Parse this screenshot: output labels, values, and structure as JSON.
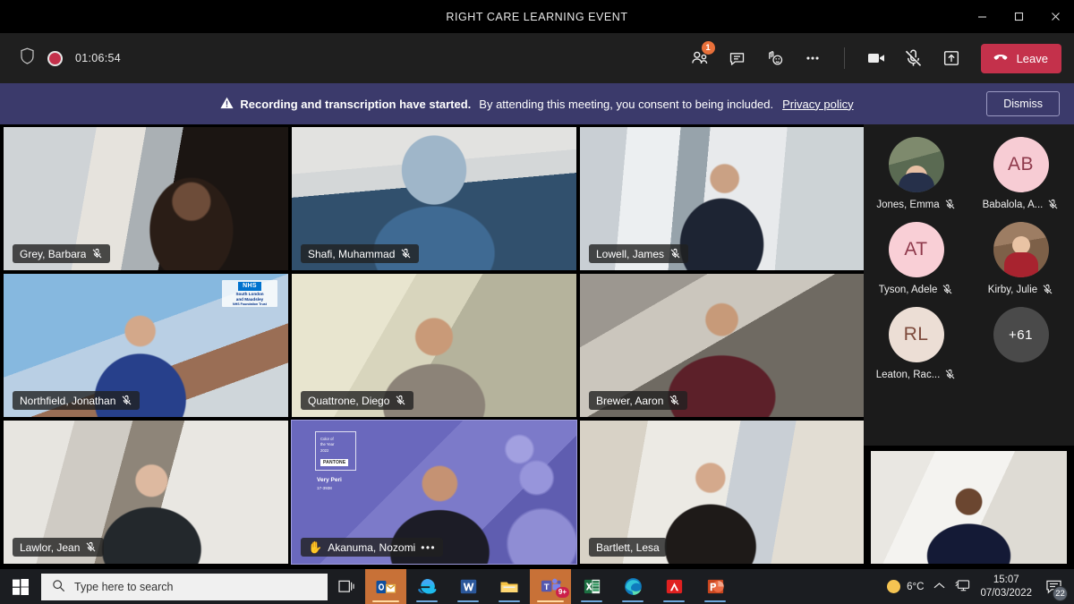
{
  "window": {
    "title": "RIGHT CARE LEARNING EVENT",
    "controls": [
      {
        "name": "minimize",
        "glyph": "minimize-icon"
      },
      {
        "name": "maximize",
        "glyph": "maximize-icon"
      },
      {
        "name": "close",
        "glyph": "close-icon"
      }
    ]
  },
  "toolbar": {
    "shield_icon": "shield-icon",
    "recording_icon": "recording-dot-icon",
    "timer": "01:06:54",
    "people_icon": "people-icon",
    "people_badge": "1",
    "chat_icon": "chat-icon",
    "reactions_icon": "raise-hand-reactions-icon",
    "more_icon": "more-options-icon",
    "camera_icon": "camera-icon",
    "mic_off_icon": "microphone-muted-icon",
    "share_icon": "share-screen-icon",
    "leave_label": "Leave",
    "leave_icon": "hangup-icon",
    "leave_color": "#c4314b"
  },
  "banner": {
    "warning_icon": "warning-icon",
    "strong": "Recording and transcription have started.",
    "text": "By attending this meeting, you consent to being included.",
    "link": "Privacy policy",
    "dismiss_label": "Dismiss",
    "background": "#3b3a6b"
  },
  "stage": {
    "tiles": [
      {
        "name": "Grey, Barbara",
        "muted": true,
        "hand_raised": false,
        "active": false,
        "more": false
      },
      {
        "name": "Shafi, Muhammad",
        "muted": true,
        "hand_raised": false,
        "active": false,
        "more": false
      },
      {
        "name": "Lowell, James",
        "muted": true,
        "hand_raised": false,
        "active": false,
        "more": false
      },
      {
        "name": "Northfield, Jonathan",
        "muted": true,
        "hand_raised": false,
        "active": false,
        "more": false
      },
      {
        "name": "Quattrone, Diego",
        "muted": true,
        "hand_raised": false,
        "active": false,
        "more": false
      },
      {
        "name": "Brewer, Aaron",
        "muted": true,
        "hand_raised": false,
        "active": false,
        "more": false
      },
      {
        "name": "Lawlor, Jean",
        "muted": true,
        "hand_raised": false,
        "active": false,
        "more": false
      },
      {
        "name": "Akanuma, Nozomi",
        "muted": false,
        "hand_raised": true,
        "active": true,
        "more": true
      },
      {
        "name": "Bartlett, Lesa",
        "muted": false,
        "hand_raised": false,
        "active": false,
        "more": false
      }
    ],
    "tile_notes": {
      "northfield_background_logo": "NHS South London and Maudsley NHS Foundation Trust",
      "akanuma_background": "PANTONE Color of the Year 2022 Very Peri 17-3938",
      "active_border_color": "#9d9bdd"
    }
  },
  "roster": {
    "participants": [
      {
        "name": "Jones, Emma",
        "initials": "",
        "photo": true,
        "muted": true,
        "avatar_bg": "#6d7a62",
        "avatar_fg": "#ffffff"
      },
      {
        "name": "Babalola, A...",
        "initials": "AB",
        "photo": false,
        "muted": true,
        "avatar_bg": "#f7ccd4",
        "avatar_fg": "#8f3a4c"
      },
      {
        "name": "Tyson, Adele",
        "initials": "AT",
        "photo": false,
        "muted": true,
        "avatar_bg": "#f9cfd6",
        "avatar_fg": "#8f3a4c"
      },
      {
        "name": "Kirby, Julie",
        "initials": "",
        "photo": true,
        "muted": true,
        "avatar_bg": "#8a6a57",
        "avatar_fg": "#ffffff"
      },
      {
        "name": "Leaton, Rac...",
        "initials": "RL",
        "photo": false,
        "muted": true,
        "avatar_bg": "#ecded5",
        "avatar_fg": "#7d4a3c"
      },
      {
        "name": "+61",
        "initials": "+61",
        "photo": false,
        "muted": false,
        "overflow": true,
        "avatar_bg": "#4a4a4a",
        "avatar_fg": "#ffffff"
      }
    ],
    "self_video": "self-video-preview"
  },
  "taskbar": {
    "start_icon": "windows-start-icon",
    "search_placeholder": "Type here to search",
    "search_icon": "search-icon",
    "taskview_icon": "task-view-icon",
    "apps": [
      {
        "name": "outlook-taskbar-icon",
        "label": "O",
        "open": true
      },
      {
        "name": "internet-explorer-taskbar-icon",
        "label": "e",
        "open": false
      },
      {
        "name": "word-taskbar-icon",
        "label": "W",
        "open": false
      },
      {
        "name": "file-explorer-taskbar-icon",
        "label": "",
        "open": false
      },
      {
        "name": "microsoft-teams-taskbar-icon",
        "label": "T",
        "open": true,
        "badge": "9+"
      },
      {
        "name": "excel-taskbar-icon",
        "label": "X",
        "open": false
      },
      {
        "name": "microsoft-edge-taskbar-icon",
        "label": "",
        "open": false
      },
      {
        "name": "adobe-acrobat-taskbar-icon",
        "label": "A",
        "open": false
      },
      {
        "name": "powerpoint-taskbar-icon",
        "label": "P",
        "open": false
      }
    ],
    "tray": {
      "weather_icon": "sun-weather-icon",
      "temperature": "6°C",
      "chevron_icon": "show-hidden-icons-chevron",
      "network_icon": "network-display-icon",
      "time": "15:07",
      "date": "07/03/2022",
      "notification_icon": "action-center-icon",
      "notification_count": "22"
    }
  }
}
